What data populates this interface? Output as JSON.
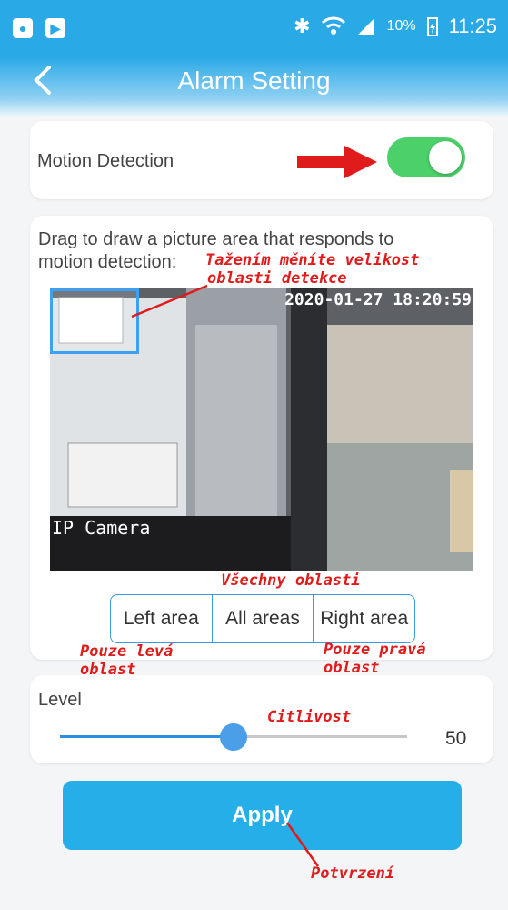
{
  "status_bar": {
    "battery": "10%",
    "time": "11:25"
  },
  "header": {
    "title": "Alarm Setting"
  },
  "motion": {
    "label": "Motion Detection",
    "enabled": true
  },
  "area": {
    "instruction_line1": "Drag to draw a picture area that responds to",
    "instruction_line2": "motion detection:",
    "annotation_resize_line1": "Tažením měníte velikost",
    "annotation_resize_line2": "oblasti detekce",
    "video_timestamp": "2020-01-27 18:20:59",
    "video_label": "IP Camera",
    "annotation_all": "Všechny oblasti",
    "segments": [
      "Left area",
      "All areas",
      "Right area"
    ],
    "selected_segment": "All areas",
    "annotation_left_line1": "Pouze levá",
    "annotation_left_line2": "oblast",
    "annotation_right_line1": "Pouze pravá",
    "annotation_right_line2": "oblast"
  },
  "level": {
    "label": "Level",
    "annotation": "Citlivost",
    "value": "50",
    "fraction": 0.5
  },
  "apply": {
    "label": "Apply",
    "annotation": "Potvrzení"
  },
  "colors": {
    "accent": "#29a9e6",
    "toggle_on": "#4cd06a",
    "annotation": "#e01b1b"
  },
  "icons": [
    "back-chevron-icon",
    "bluetooth-icon",
    "wifi-icon",
    "signal-icon",
    "battery-icon"
  ]
}
